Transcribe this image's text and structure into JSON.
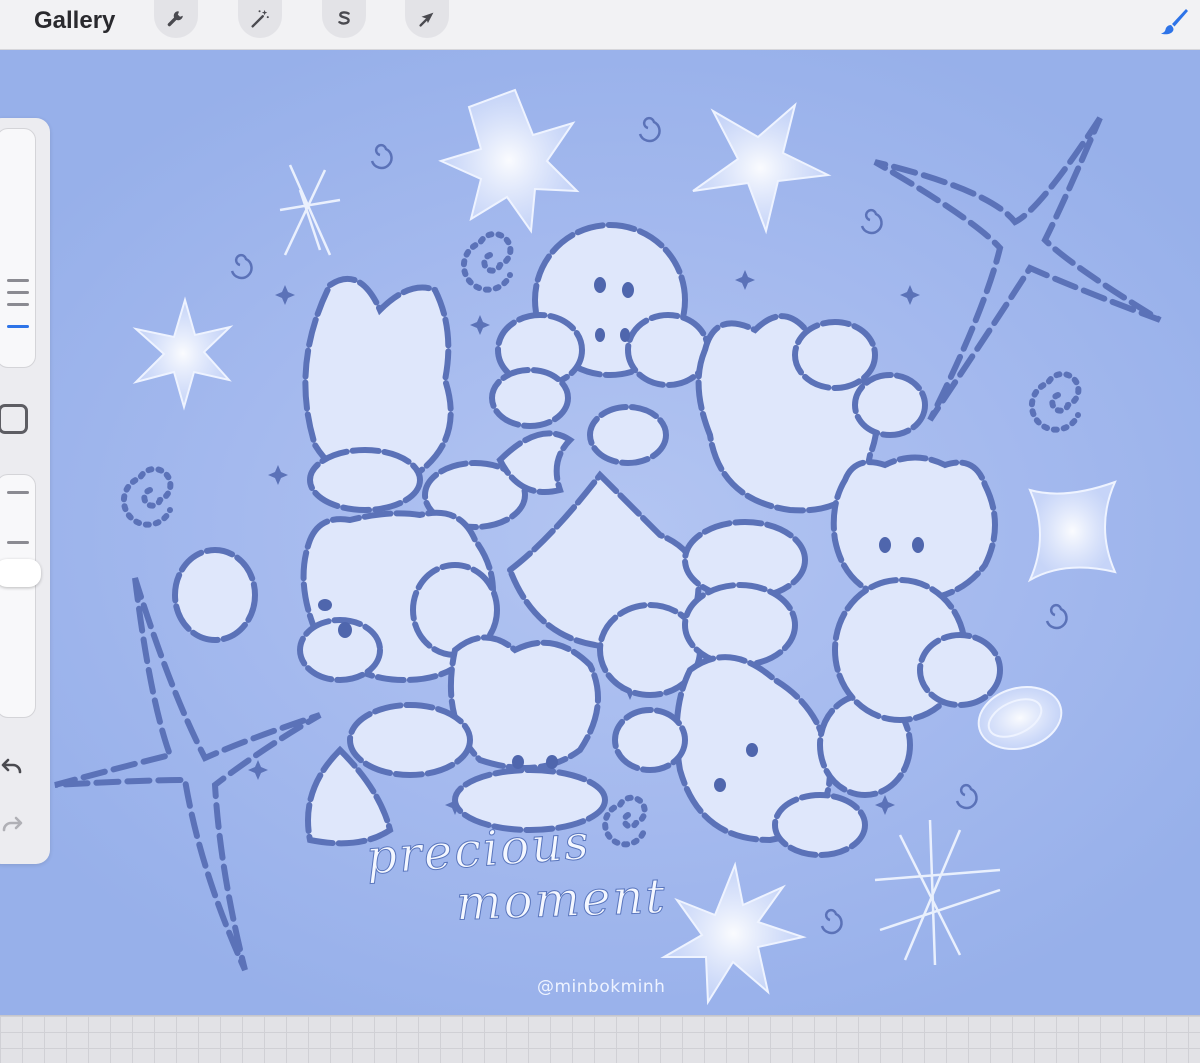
{
  "toolbar": {
    "gallery_label": "Gallery",
    "tools": [
      {
        "name": "actions",
        "icon": "wrench-icon"
      },
      {
        "name": "adjustments",
        "icon": "magic-wand-icon"
      },
      {
        "name": "selection",
        "icon": "selection-s-icon"
      },
      {
        "name": "transform",
        "icon": "arrow-cursor-icon"
      }
    ],
    "active_tool_icon": "brush-icon",
    "accent_color": "#2e74e8"
  },
  "sidebar": {
    "brush_size_level": 0.55,
    "opacity_level": 0.2,
    "modifier_icon": "square-modifier-icon",
    "undo_icon": "undo-arrow-icon",
    "redo_icon": "redo-arrow-icon"
  },
  "artwork": {
    "title_line_1": "precious",
    "title_line_2": "moment",
    "signature": "@minbokminh",
    "background_color": "#a4b9ee",
    "line_color": "#5b72b8",
    "fill_color": "#dfe7fb",
    "characters": [
      "wolf",
      "bunny-girl",
      "bunny",
      "fox",
      "cat",
      "puppy",
      "dog",
      "quokka",
      "bear"
    ]
  }
}
